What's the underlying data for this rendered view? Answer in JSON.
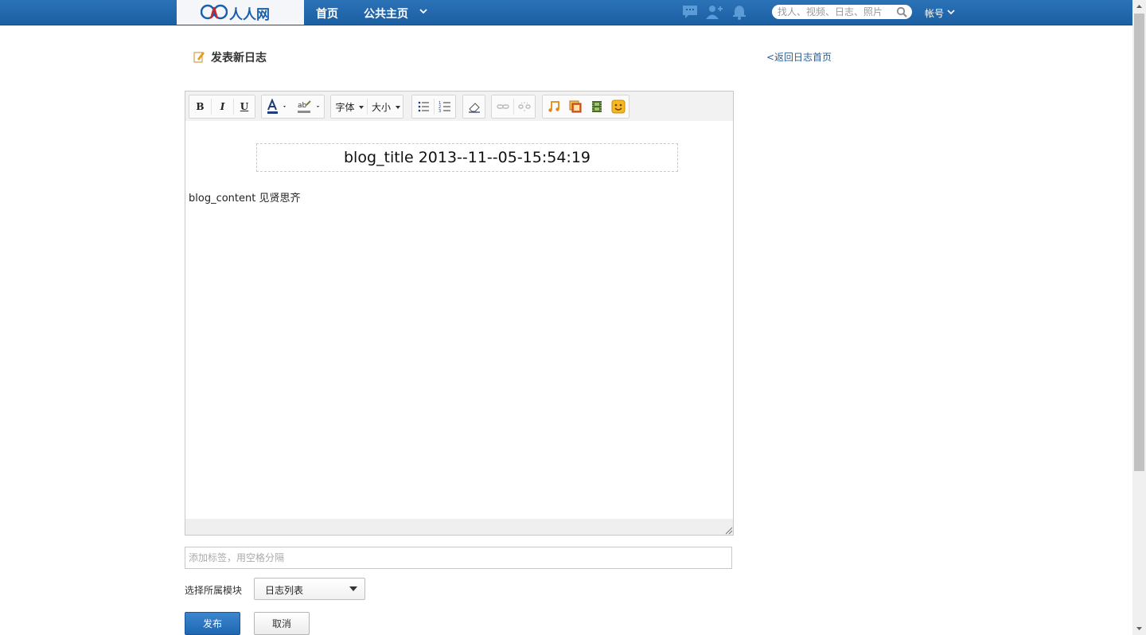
{
  "header": {
    "logo_text": "人人网",
    "nav": {
      "home": "首页",
      "public": "公共主页"
    },
    "icons": [
      "chat-icon",
      "add-friend-icon",
      "notification-bell-icon"
    ],
    "search_placeholder": "找人、视频、日志、照片",
    "account": "帐号",
    "colors": {
      "bar": "#1c5fa3",
      "logo": "#1a5fab"
    }
  },
  "page": {
    "title": "发表新日志",
    "back_link": "<返回日志首页"
  },
  "toolbar": {
    "bold": "B",
    "italic": "I",
    "underline": "U",
    "font_family": "字体",
    "font_size": "大小"
  },
  "editor": {
    "title": "blog_title 2013--11--05-15:54:19",
    "content": "blog_content 见贤思齐"
  },
  "form": {
    "tags_placeholder": "添加标签，用空格分隔",
    "module_label": "选择所属模块",
    "module_value": "日志列表",
    "publish": "发布",
    "cancel": "取消"
  }
}
